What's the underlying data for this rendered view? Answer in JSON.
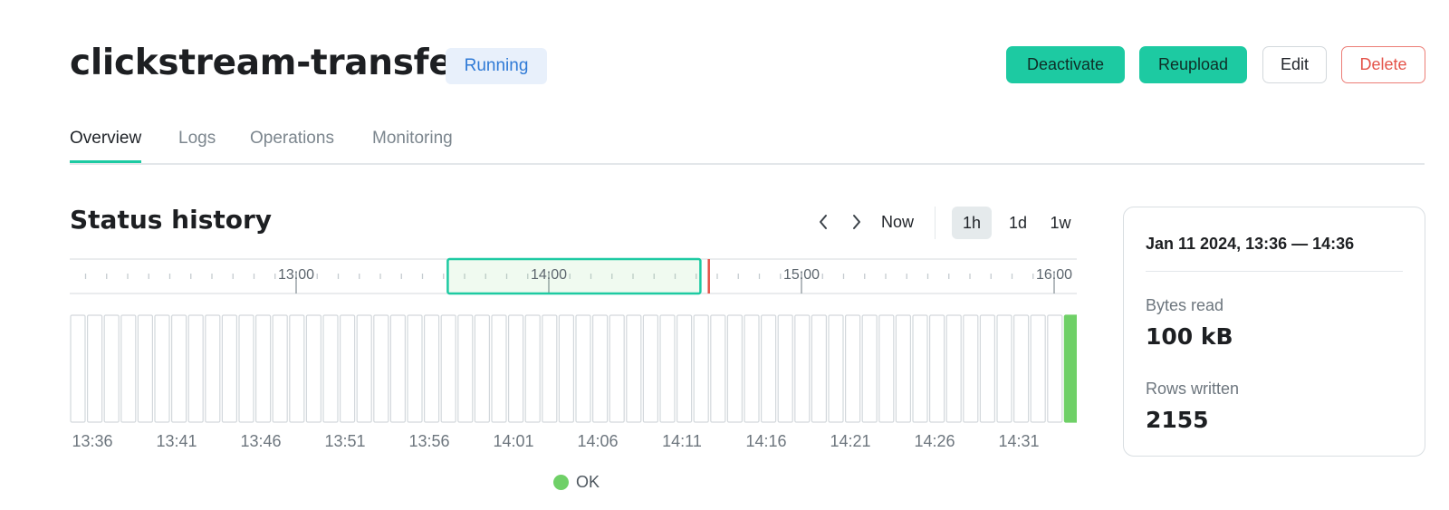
{
  "header": {
    "title": "clickstream-transfer",
    "status_badge": "Running",
    "actions": {
      "deactivate": "Deactivate",
      "reupload": "Reupload",
      "edit": "Edit",
      "delete": "Delete"
    }
  },
  "tabs": [
    {
      "label": "Overview",
      "active": true
    },
    {
      "label": "Logs",
      "active": false
    },
    {
      "label": "Operations",
      "active": false
    },
    {
      "label": "Monitoring",
      "active": false
    }
  ],
  "status_history": {
    "title": "Status history",
    "controls": {
      "prev_icon": "chevron-left-icon",
      "next_icon": "chevron-right-icon",
      "now": "Now",
      "ranges": [
        "1h",
        "1d",
        "1w"
      ],
      "active_range": "1h"
    },
    "timeline": {
      "labels": [
        "13:00",
        "14:00",
        "15:00",
        "16:00"
      ],
      "selection_start": "13:36",
      "selection_end": "14:36",
      "now_marker": "14:38"
    },
    "time_labels": [
      "13:36",
      "13:41",
      "13:46",
      "13:51",
      "13:56",
      "14:01",
      "14:06",
      "14:11",
      "14:16",
      "14:21",
      "14:26",
      "14:31"
    ],
    "bar_count": 60,
    "ok_bars": [
      59
    ],
    "legend": [
      {
        "label": "OK",
        "color": "#6fd067"
      }
    ]
  },
  "info": {
    "range": "Jan 11 2024, 13:36 — 14:36",
    "bytes_read_label": "Bytes read",
    "bytes_read_value": "100 kB",
    "rows_written_label": "Rows written",
    "rows_written_value": "2155"
  },
  "colors": {
    "accent": "#1dcaa2",
    "ok": "#6fd067",
    "danger": "#e4544a",
    "now_marker": "#e4544a",
    "badge_bg": "#e8f0fb",
    "badge_text": "#2f7ad6"
  }
}
